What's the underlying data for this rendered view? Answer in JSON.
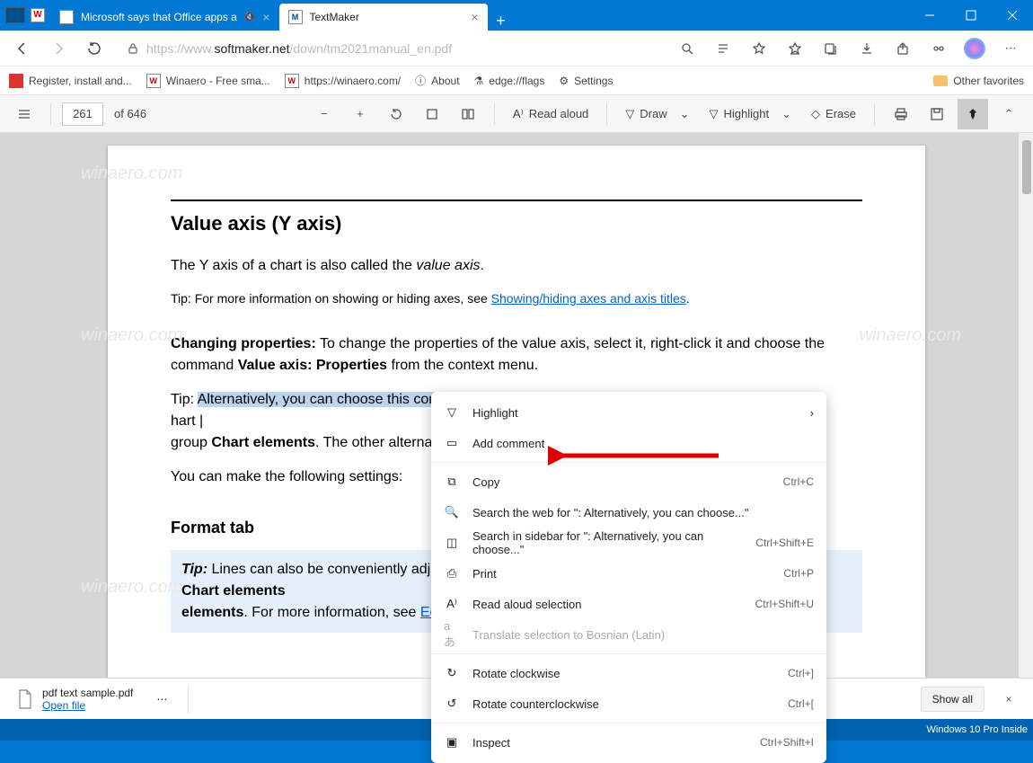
{
  "titlebar": {
    "tabs": [
      {
        "label": "Microsoft says that Office apps a",
        "active": false
      },
      {
        "label": "TextMaker",
        "active": true
      }
    ]
  },
  "addressbar": {
    "url_dim1": "https://www.",
    "url_host": "softmaker.net",
    "url_dim2": "/down/tm2021manual_en.pdf"
  },
  "favorites": {
    "items": [
      "Register, install and...",
      "Winaero - Free sma...",
      "https://winaero.com/",
      "About",
      "edge://flags",
      "Settings"
    ],
    "other": "Other favorites"
  },
  "pdfbar": {
    "page": "261",
    "of": "of 646",
    "read": "Read aloud",
    "draw": "Draw",
    "highlight": "Highlight",
    "erase": "Erase"
  },
  "doc": {
    "h2": "Value axis (Y axis)",
    "p1a": "The Y axis of a chart is also called the ",
    "p1b": "value axis",
    "tip1a": "Tip: For more information on showing or hiding axes, see  ",
    "tip1link": "Showing/hiding axes and axis titles",
    "cp_bold": "Changing properties:",
    "cp_rest": " To change the properties of the value axis, select it, right-click it and choose the command ",
    "cp_bold2": "Value axis: Properties",
    "cp_rest2": " from the context menu.",
    "alt_tip": "Tip: ",
    "alt_sel": "Alternatively, you can choose this comm",
    "alt_rest_right": "hart |",
    "alt_line2a": " group ",
    "alt_line2b": "Chart elements",
    "alt_line2c": ". The other alternative",
    "p2": "You can make the following settings:",
    "h3": "Format tab",
    "box_tip": "Tip:",
    "box_a": " Lines can also be conveniently adjusted",
    "box_b": "Chart elements",
    "box_c": ". For more information, see ",
    "box_link": "Editing"
  },
  "context_menu": {
    "items": [
      {
        "label": "Highlight",
        "shortcut": "",
        "chevron": true
      },
      {
        "label": "Add comment",
        "shortcut": ""
      },
      {
        "label": "Copy",
        "shortcut": "Ctrl+C"
      },
      {
        "label": "Search the web for \": Alternatively, you can choose...\"",
        "shortcut": ""
      },
      {
        "label": "Search in sidebar for \": Alternatively, you can choose...\"",
        "shortcut": "Ctrl+Shift+E"
      },
      {
        "label": "Print",
        "shortcut": "Ctrl+P"
      },
      {
        "label": "Read aloud selection",
        "shortcut": "Ctrl+Shift+U"
      },
      {
        "label": "Translate selection to Bosnian (Latin)",
        "shortcut": "",
        "disabled": true
      },
      {
        "label": "Rotate clockwise",
        "shortcut": "Ctrl+]"
      },
      {
        "label": "Rotate counterclockwise",
        "shortcut": "Ctrl+["
      },
      {
        "label": "Inspect",
        "shortcut": "Ctrl+Shift+I"
      }
    ]
  },
  "downloads": {
    "file": "pdf text sample.pdf",
    "open": "Open file",
    "showall": "Show all"
  },
  "taskbar": {
    "text": "Windows 10 Pro Inside"
  },
  "watermark": "winaero.com"
}
